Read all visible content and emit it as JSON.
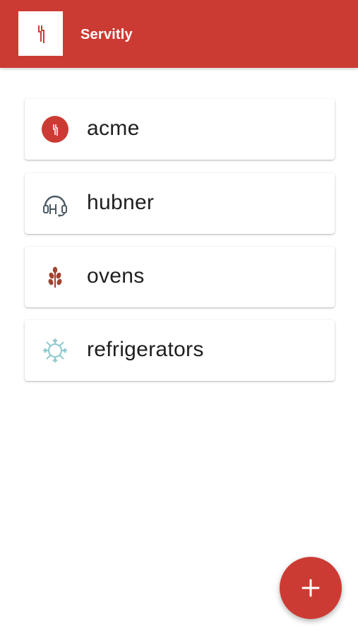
{
  "header": {
    "title": "Servitly",
    "logo_icon": "servitly-logo-icon",
    "background_color": "#cc3b33"
  },
  "items": [
    {
      "label": "acme",
      "icon": "acme-logo-icon",
      "color": "#cc3b33"
    },
    {
      "label": "hubner",
      "icon": "headset-icon",
      "color": "#4a5a63"
    },
    {
      "label": "ovens",
      "icon": "wheat-icon",
      "color": "#a5412e"
    },
    {
      "label": "refrigerators",
      "icon": "snowflake-icon",
      "color": "#8ec9cf"
    }
  ],
  "fab": {
    "icon": "plus-icon",
    "background_color": "#cc3b33"
  }
}
